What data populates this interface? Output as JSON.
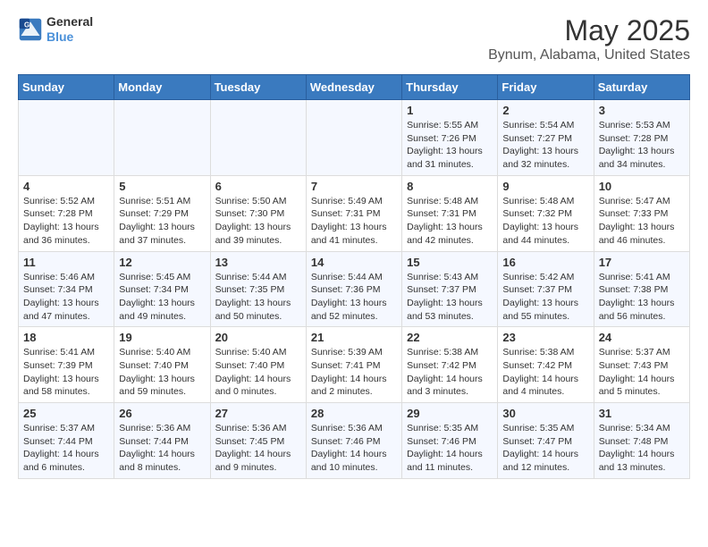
{
  "logo": {
    "line1": "General",
    "line2": "Blue"
  },
  "title": "May 2025",
  "subtitle": "Bynum, Alabama, United States",
  "days_of_week": [
    "Sunday",
    "Monday",
    "Tuesday",
    "Wednesday",
    "Thursday",
    "Friday",
    "Saturday"
  ],
  "weeks": [
    [
      {
        "day": "",
        "info": ""
      },
      {
        "day": "",
        "info": ""
      },
      {
        "day": "",
        "info": ""
      },
      {
        "day": "",
        "info": ""
      },
      {
        "day": "1",
        "info": "Sunrise: 5:55 AM\nSunset: 7:26 PM\nDaylight: 13 hours and 31 minutes."
      },
      {
        "day": "2",
        "info": "Sunrise: 5:54 AM\nSunset: 7:27 PM\nDaylight: 13 hours and 32 minutes."
      },
      {
        "day": "3",
        "info": "Sunrise: 5:53 AM\nSunset: 7:28 PM\nDaylight: 13 hours and 34 minutes."
      }
    ],
    [
      {
        "day": "4",
        "info": "Sunrise: 5:52 AM\nSunset: 7:28 PM\nDaylight: 13 hours and 36 minutes."
      },
      {
        "day": "5",
        "info": "Sunrise: 5:51 AM\nSunset: 7:29 PM\nDaylight: 13 hours and 37 minutes."
      },
      {
        "day": "6",
        "info": "Sunrise: 5:50 AM\nSunset: 7:30 PM\nDaylight: 13 hours and 39 minutes."
      },
      {
        "day": "7",
        "info": "Sunrise: 5:49 AM\nSunset: 7:31 PM\nDaylight: 13 hours and 41 minutes."
      },
      {
        "day": "8",
        "info": "Sunrise: 5:48 AM\nSunset: 7:31 PM\nDaylight: 13 hours and 42 minutes."
      },
      {
        "day": "9",
        "info": "Sunrise: 5:48 AM\nSunset: 7:32 PM\nDaylight: 13 hours and 44 minutes."
      },
      {
        "day": "10",
        "info": "Sunrise: 5:47 AM\nSunset: 7:33 PM\nDaylight: 13 hours and 46 minutes."
      }
    ],
    [
      {
        "day": "11",
        "info": "Sunrise: 5:46 AM\nSunset: 7:34 PM\nDaylight: 13 hours and 47 minutes."
      },
      {
        "day": "12",
        "info": "Sunrise: 5:45 AM\nSunset: 7:34 PM\nDaylight: 13 hours and 49 minutes."
      },
      {
        "day": "13",
        "info": "Sunrise: 5:44 AM\nSunset: 7:35 PM\nDaylight: 13 hours and 50 minutes."
      },
      {
        "day": "14",
        "info": "Sunrise: 5:44 AM\nSunset: 7:36 PM\nDaylight: 13 hours and 52 minutes."
      },
      {
        "day": "15",
        "info": "Sunrise: 5:43 AM\nSunset: 7:37 PM\nDaylight: 13 hours and 53 minutes."
      },
      {
        "day": "16",
        "info": "Sunrise: 5:42 AM\nSunset: 7:37 PM\nDaylight: 13 hours and 55 minutes."
      },
      {
        "day": "17",
        "info": "Sunrise: 5:41 AM\nSunset: 7:38 PM\nDaylight: 13 hours and 56 minutes."
      }
    ],
    [
      {
        "day": "18",
        "info": "Sunrise: 5:41 AM\nSunset: 7:39 PM\nDaylight: 13 hours and 58 minutes."
      },
      {
        "day": "19",
        "info": "Sunrise: 5:40 AM\nSunset: 7:40 PM\nDaylight: 13 hours and 59 minutes."
      },
      {
        "day": "20",
        "info": "Sunrise: 5:40 AM\nSunset: 7:40 PM\nDaylight: 14 hours and 0 minutes."
      },
      {
        "day": "21",
        "info": "Sunrise: 5:39 AM\nSunset: 7:41 PM\nDaylight: 14 hours and 2 minutes."
      },
      {
        "day": "22",
        "info": "Sunrise: 5:38 AM\nSunset: 7:42 PM\nDaylight: 14 hours and 3 minutes."
      },
      {
        "day": "23",
        "info": "Sunrise: 5:38 AM\nSunset: 7:42 PM\nDaylight: 14 hours and 4 minutes."
      },
      {
        "day": "24",
        "info": "Sunrise: 5:37 AM\nSunset: 7:43 PM\nDaylight: 14 hours and 5 minutes."
      }
    ],
    [
      {
        "day": "25",
        "info": "Sunrise: 5:37 AM\nSunset: 7:44 PM\nDaylight: 14 hours and 6 minutes."
      },
      {
        "day": "26",
        "info": "Sunrise: 5:36 AM\nSunset: 7:44 PM\nDaylight: 14 hours and 8 minutes."
      },
      {
        "day": "27",
        "info": "Sunrise: 5:36 AM\nSunset: 7:45 PM\nDaylight: 14 hours and 9 minutes."
      },
      {
        "day": "28",
        "info": "Sunrise: 5:36 AM\nSunset: 7:46 PM\nDaylight: 14 hours and 10 minutes."
      },
      {
        "day": "29",
        "info": "Sunrise: 5:35 AM\nSunset: 7:46 PM\nDaylight: 14 hours and 11 minutes."
      },
      {
        "day": "30",
        "info": "Sunrise: 5:35 AM\nSunset: 7:47 PM\nDaylight: 14 hours and 12 minutes."
      },
      {
        "day": "31",
        "info": "Sunrise: 5:34 AM\nSunset: 7:48 PM\nDaylight: 14 hours and 13 minutes."
      }
    ]
  ]
}
